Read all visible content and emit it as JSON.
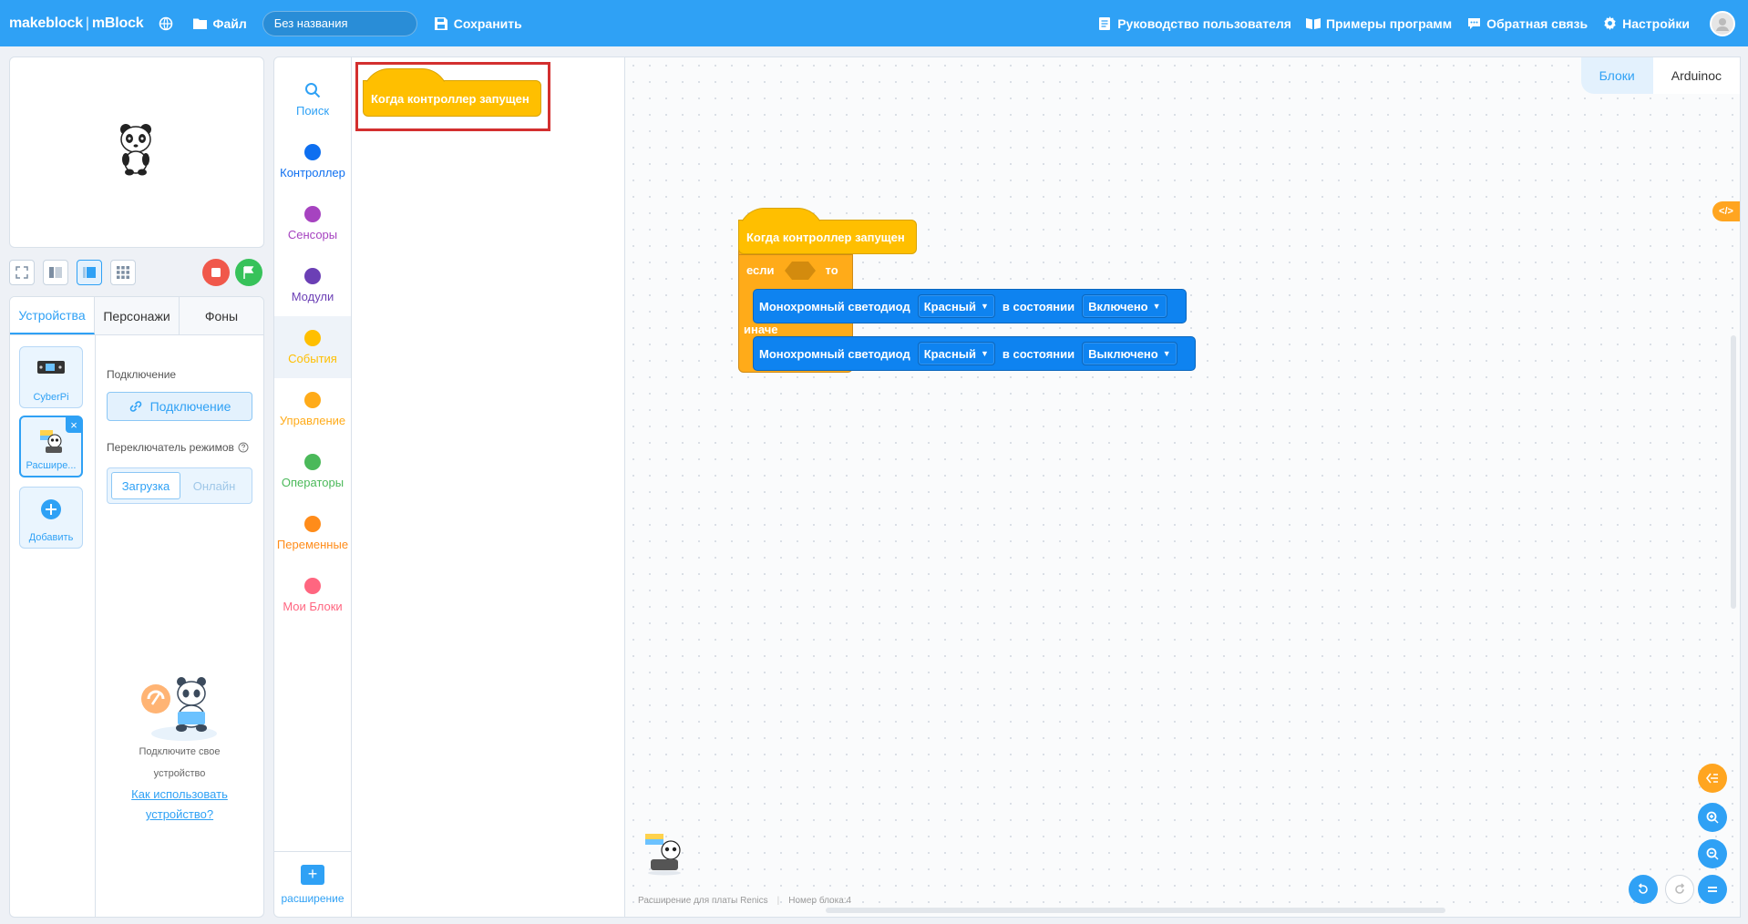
{
  "topbar": {
    "brand_left": "makeblock",
    "brand_sep": "|",
    "brand_right": "mBlock",
    "file_label": "Файл",
    "title_value": "Без названия",
    "save_label": "Сохранить",
    "guide_label": "Руководство пользователя",
    "examples_label": "Примеры программ",
    "feedback_label": "Обратная связь",
    "settings_label": "Настройки"
  },
  "device_panel": {
    "tabs": [
      "Устройства",
      "Персонажи",
      "Фоны"
    ],
    "devices": [
      "CyberPi",
      "Расшире..."
    ],
    "add_label": "Добавить",
    "connection_title": "Подключение",
    "connect_button": "Подключение",
    "mode_switch_title": "Переключатель режимов",
    "mode_upload": "Загрузка",
    "mode_online": "Онлайн",
    "hint_line1": "Подключите свое",
    "hint_line2": "устройство",
    "hint_link1": "Как использовать",
    "hint_link2": "устройство?"
  },
  "categories": [
    {
      "label": "Поиск",
      "color": "#2fa1f5"
    },
    {
      "label": "Контроллер",
      "color": "#0e6ff0"
    },
    {
      "label": "Сенсоры",
      "color": "#a643c0"
    },
    {
      "label": "Модули",
      "color": "#6b3fb5"
    },
    {
      "label": "События",
      "color": "#ffbf00"
    },
    {
      "label": "Управление",
      "color": "#ffab19"
    },
    {
      "label": "Операторы",
      "color": "#4bb95a"
    },
    {
      "label": "Переменные",
      "color": "#ff8c1a"
    },
    {
      "label": "Мои Блоки",
      "color": "#ff6680"
    }
  ],
  "extension_label": "расширение",
  "palette": {
    "hat_block": "Когда контроллер запущен"
  },
  "workspace": {
    "tab_blocks": "Блоки",
    "tab_arduino": "Arduinoc",
    "code_toggle": "</>",
    "script": {
      "hat": "Когда контроллер запущен",
      "if_label": "если",
      "then_label": "то",
      "else_label": "иначе",
      "action1": {
        "label": "Монохромный светодиод",
        "color": "Красный",
        "state_label": "в состоянии",
        "state": "Включено"
      },
      "action2": {
        "label": "Монохромный светодиод",
        "color": "Красный",
        "state_label": "в состоянии",
        "state": "Выключено"
      }
    },
    "status_ext": "Расширение для платы Renics",
    "status_block": "Номер блока:4"
  },
  "colors": {
    "accent": "#2fa1f5",
    "events": "#ffbf00",
    "control": "#ffab19",
    "action": "#0e83f0"
  }
}
